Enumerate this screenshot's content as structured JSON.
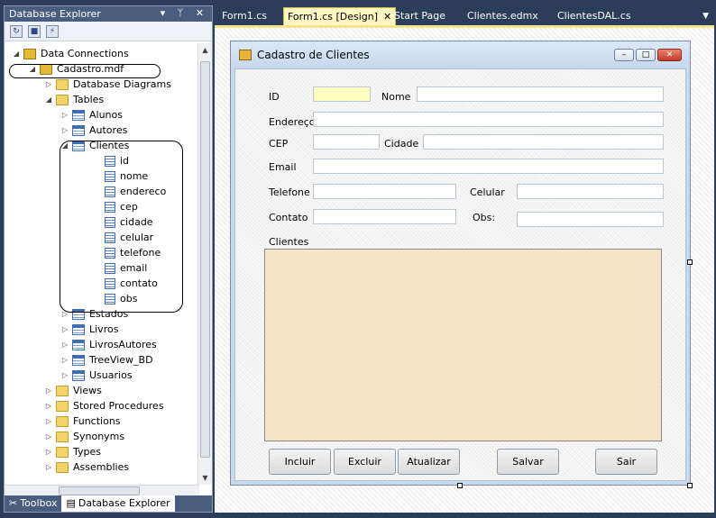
{
  "explorer": {
    "title": "Database Explorer",
    "pin_controls": "▾ ᛘ ✕",
    "tree": [
      {
        "label": "Data Connections",
        "icon": "conn",
        "level": 0,
        "arrow": "◢"
      },
      {
        "label": "Cadastro.mdf",
        "icon": "db",
        "level": 1,
        "arrow": "◢"
      },
      {
        "label": "Database Diagrams",
        "icon": "folder",
        "level": 2,
        "arrow": "▷"
      },
      {
        "label": "Tables",
        "icon": "folder",
        "level": 2,
        "arrow": "◢"
      },
      {
        "label": "Alunos",
        "icon": "table",
        "level": 3,
        "arrow": "▷"
      },
      {
        "label": "Autores",
        "icon": "table",
        "level": 3,
        "arrow": "▷"
      },
      {
        "label": "Clientes",
        "icon": "table",
        "level": 3,
        "arrow": "◢"
      },
      {
        "label": "id",
        "icon": "col",
        "level": 4,
        "arrow": ""
      },
      {
        "label": "nome",
        "icon": "col",
        "level": 4,
        "arrow": ""
      },
      {
        "label": "endereco",
        "icon": "col",
        "level": 4,
        "arrow": ""
      },
      {
        "label": "cep",
        "icon": "col",
        "level": 4,
        "arrow": ""
      },
      {
        "label": "cidade",
        "icon": "col",
        "level": 4,
        "arrow": ""
      },
      {
        "label": "celular",
        "icon": "col",
        "level": 4,
        "arrow": ""
      },
      {
        "label": "telefone",
        "icon": "col",
        "level": 4,
        "arrow": ""
      },
      {
        "label": "email",
        "icon": "col",
        "level": 4,
        "arrow": ""
      },
      {
        "label": "contato",
        "icon": "col",
        "level": 4,
        "arrow": ""
      },
      {
        "label": "obs",
        "icon": "col",
        "level": 4,
        "arrow": ""
      },
      {
        "label": "Estados",
        "icon": "table",
        "level": 3,
        "arrow": "▷"
      },
      {
        "label": "Livros",
        "icon": "table",
        "level": 3,
        "arrow": "▷"
      },
      {
        "label": "LivrosAutores",
        "icon": "table",
        "level": 3,
        "arrow": "▷"
      },
      {
        "label": "TreeView_BD",
        "icon": "table",
        "level": 3,
        "arrow": "▷"
      },
      {
        "label": "Usuarios",
        "icon": "table",
        "level": 3,
        "arrow": "▷"
      },
      {
        "label": "Views",
        "icon": "folder",
        "level": 2,
        "arrow": "▷"
      },
      {
        "label": "Stored Procedures",
        "icon": "folder",
        "level": 2,
        "arrow": "▷"
      },
      {
        "label": "Functions",
        "icon": "folder",
        "level": 2,
        "arrow": "▷"
      },
      {
        "label": "Synonyms",
        "icon": "folder",
        "level": 2,
        "arrow": "▷"
      },
      {
        "label": "Types",
        "icon": "folder",
        "level": 2,
        "arrow": "▷"
      },
      {
        "label": "Assemblies",
        "icon": "folder",
        "level": 2,
        "arrow": "▷"
      }
    ],
    "bottom_tabs": {
      "toolbox": "Toolbox",
      "database_explorer": "Database Explorer"
    }
  },
  "doc_tabs": [
    {
      "label": "Form1.cs",
      "active": false
    },
    {
      "label": "Form1.cs [Design]",
      "active": true
    },
    {
      "label": "Start Page",
      "active": false
    },
    {
      "label": "Clientes.edmx",
      "active": false
    },
    {
      "label": "ClientesDAL.cs",
      "active": false
    }
  ],
  "form": {
    "title": "Cadastro de Clientes",
    "labels": {
      "id": "ID",
      "nome": "Nome",
      "endereco": "Endereço",
      "cep": "CEP",
      "cidade": "Cidade",
      "email": "Email",
      "telefone": "Telefone",
      "celular": "Celular",
      "contato": "Contato",
      "obs": "Obs:",
      "clientes": "Clientes"
    },
    "buttons": {
      "incluir": "Incluir",
      "excluir": "Excluir",
      "atualizar": "Atualizar",
      "salvar": "Salvar",
      "sair": "Sair"
    }
  },
  "colors": {
    "panel_title": "#4b5d7e",
    "id_field": "#ffffc0",
    "grid_bg": "#f4e5c6",
    "active_tab": "#fff7c2"
  }
}
